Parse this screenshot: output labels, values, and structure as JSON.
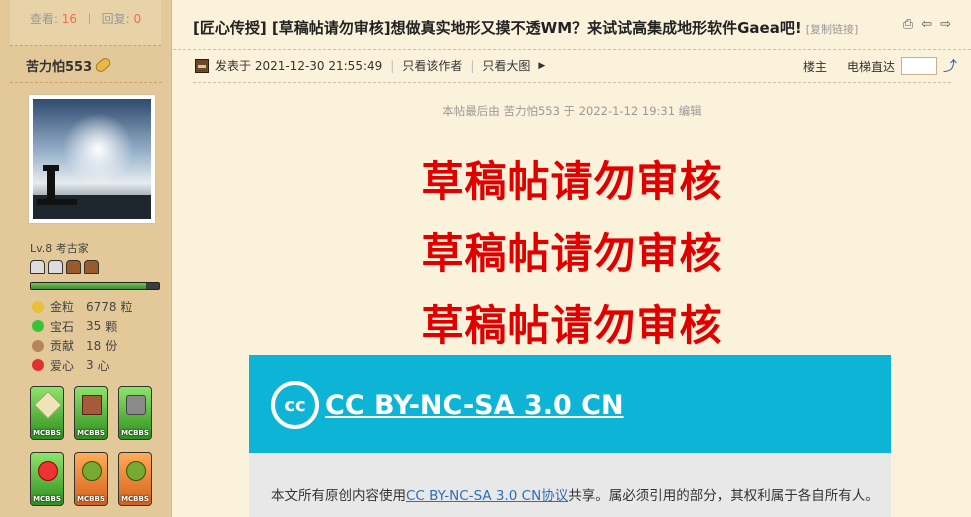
{
  "sidebar": {
    "views_label": "查看:",
    "views_count": "16",
    "replies_label": "回复:",
    "replies_count": "0",
    "username": "苦力怕553",
    "level": "Lv.8 考古家",
    "exp_progress": 0.9,
    "stats": [
      {
        "icon": "gold-nugget-icon",
        "label": "金粒",
        "value": "6778",
        "unit": "粒",
        "color": "#e7c13a"
      },
      {
        "icon": "emerald-icon",
        "label": "宝石",
        "value": "35",
        "unit": "颗",
        "color": "#3ec13a"
      },
      {
        "icon": "cookie-icon",
        "label": "贡献",
        "value": "18",
        "unit": "份",
        "color": "#b6865a"
      },
      {
        "icon": "apple-icon",
        "label": "爱心",
        "value": "3",
        "unit": "心",
        "color": "#e03030"
      }
    ],
    "medal_label": "MCBBS"
  },
  "post": {
    "title": "[匠心传授] [草稿帖请勿审核]想做真实地形又摸不透WM？来试试高集成地形软件Gaea吧!",
    "copy_link": "[复制链接]",
    "posted_at": "发表于 2021-12-30 21:55:49",
    "only_author": "只看该作者",
    "only_images": "只看大图",
    "floor_label": "楼主",
    "elevator_label": "电梯直达",
    "edited_note": "本帖最后由 苦力怕553 于 2022-1-12 19:31 编辑",
    "big_lines": [
      "草稿帖请勿审核",
      "草稿帖请勿审核",
      "草稿帖请勿审核"
    ],
    "cc_icon": "cc",
    "cc_text": "CC BY-NC-SA 3.0 CN",
    "body_prefix": "本文所有原创内容使用",
    "body_link": "CC BY-NC-SA 3.0 CN协议",
    "body_suffix": "共享。属必须引用的部分，其权利属于各自所有人。"
  },
  "colors": {
    "accent_red": "#e10000",
    "cc_blue": "#0eb4d6"
  }
}
